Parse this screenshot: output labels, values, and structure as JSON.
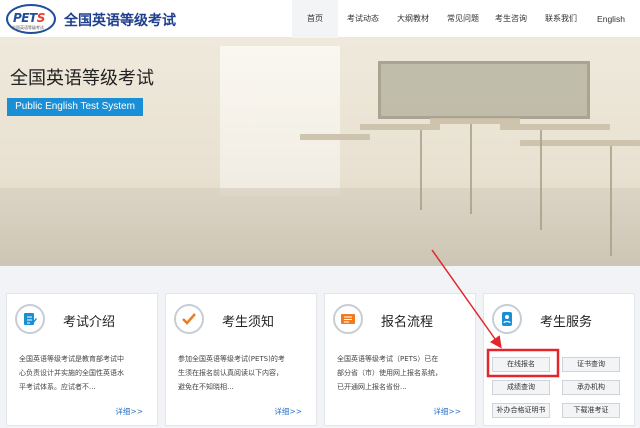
{
  "header": {
    "logo_text_main": "PET",
    "logo_text_accent": "S",
    "logo_subtitle": "全国英语等级考试",
    "site_title": "全国英语等级考试",
    "nav": [
      "首页",
      "考试动态",
      "大纲教材",
      "常见问题",
      "考生咨询",
      "联系我们",
      "English"
    ],
    "active_nav": "首页"
  },
  "hero": {
    "title": "全国英语等级考试",
    "badge": "Public English Test System"
  },
  "cards": [
    {
      "title": "考试介绍",
      "icon": "document-edit-icon",
      "lines": [
        "全国英语等级考试是教育部考试中",
        "心负责设计并实施的全国性英语水",
        "平考试体系。应试者不..."
      ],
      "more": "详细>>"
    },
    {
      "title": "考生须知",
      "icon": "checkmark-icon",
      "lines": [
        "参加全国英语等级考试(PETS)的考",
        "生须在报名前认真阅读以下内容，",
        "避免在不知晓相..."
      ],
      "more": "详细>>"
    },
    {
      "title": "报名流程",
      "icon": "form-list-icon",
      "lines": [
        "全国英语等级考试（PETS）已在",
        "部分省（市）使用网上报名系统，",
        "已开通网上报名省份..."
      ],
      "more": "详细>>"
    },
    {
      "title": "考生服务",
      "icon": "id-card-icon",
      "buttons": [
        "在线报名",
        "证书查询",
        "成绩查询",
        "承办机构",
        "补办合格证明书",
        "下载准考证"
      ]
    }
  ],
  "colors": {
    "brand_blue": "#1f3f8f",
    "badge_blue": "#1a8fd6",
    "link_blue": "#2a72c8",
    "highlight_red": "#e4262c",
    "icon_orange": "#f07b22"
  }
}
